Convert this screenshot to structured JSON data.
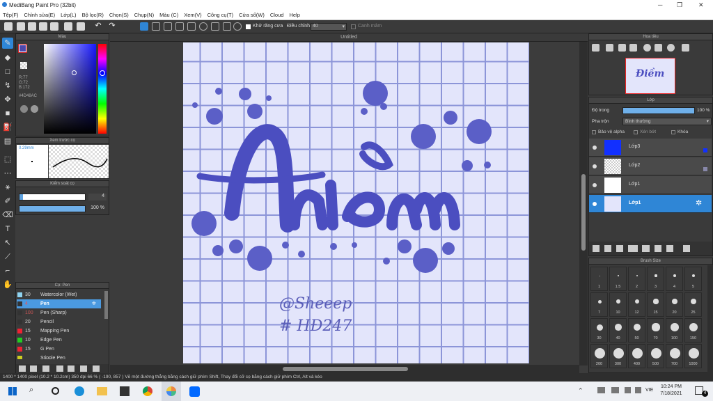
{
  "window": {
    "title": "MediBang Paint Pro (32bit)"
  },
  "menu": [
    "Tệp(F)",
    "Chỉnh sửa(E)",
    "Lớp(L)",
    "Bộ lọc(R)",
    "Chọn(S)",
    "Chụp(N)",
    "Màu (C)",
    "Xem(V)",
    "Công cụ(T)",
    "Cửa sổ(W)",
    "Cloud",
    "Help"
  ],
  "toolbar": {
    "antialias_label": "Khử răng cưa",
    "adjust_label": "Điều chỉnh",
    "adjust_value": "40",
    "snap_label": "Canh mảm"
  },
  "color_panel": {
    "title": "Màu",
    "rgb": [
      "R:77",
      "G:72",
      "B:172"
    ],
    "hex": "#4D48AC"
  },
  "brush_preview": {
    "title": "Xem trước cọ",
    "size": "0.29mm"
  },
  "brush_size_panel": {
    "title": "Kiểm soát cọ",
    "size_value": "4",
    "opacity_value": "100 %"
  },
  "brush_list": {
    "title": "Cọ: Pen",
    "items": [
      {
        "size": "30",
        "name": "Watercolor (Wet)"
      },
      {
        "size": "4",
        "name": "Pen"
      },
      {
        "size": "100",
        "name": "Pen (Sharp)"
      },
      {
        "size": "20",
        "name": "Pencil"
      },
      {
        "size": "15",
        "name": "Mapping Pen"
      },
      {
        "size": "10",
        "name": "Edge Pen"
      },
      {
        "size": "15",
        "name": "G Pen"
      },
      {
        "size": "",
        "name": "Stipple Pen"
      }
    ]
  },
  "canvas": {
    "tab_title": "Untitled",
    "title_text": "Điềm",
    "signature_line1": "@Sheeep",
    "signature_line2": "# HĐ247"
  },
  "navigator": {
    "title": "Hoa tiêu"
  },
  "layer_panel": {
    "title": "Lớp",
    "opacity_label": "Độ trong",
    "opacity_value": "100 %",
    "blend_label": "Pha trộn",
    "blend_value": "Bình thường",
    "protect_alpha": "Bảo vệ alpha",
    "clipping": "Xén bớt",
    "lock": "Khóa",
    "layers": [
      {
        "name": "Lớp3"
      },
      {
        "name": "Lớp2"
      },
      {
        "name": "Lớp1"
      },
      {
        "name": "Lớp1"
      }
    ]
  },
  "brush_size_grid": {
    "title": "Brush Size",
    "labels": [
      "1",
      "1.5",
      "2",
      "3",
      "4",
      "5",
      "7",
      "10",
      "12",
      "15",
      "20",
      "25",
      "30",
      "40",
      "50",
      "70",
      "100",
      "150",
      "200",
      "300",
      "400",
      "500",
      "700",
      "1000"
    ]
  },
  "status": {
    "dimensions": "1400 * 1400 pixel",
    "physical": "(10.2 * 10.2cm)",
    "dpi": "350 dpi",
    "zoom": "66 %",
    "coords": "( -190, 857 )",
    "hint": "Vẽ một đường thẳng bằng cách giữ phím Shift, Thay đổi cỡ cọ bằng cách giữ phím Ctrl, Alt và kéo"
  },
  "taskbar": {
    "lang": "VIE",
    "time": "10:24 PM",
    "date": "7/18/2021",
    "notifications": "4"
  },
  "colors": {
    "accent": "#2f86d6",
    "ink": "#4d48ac",
    "paper": "#e3e5fb"
  }
}
